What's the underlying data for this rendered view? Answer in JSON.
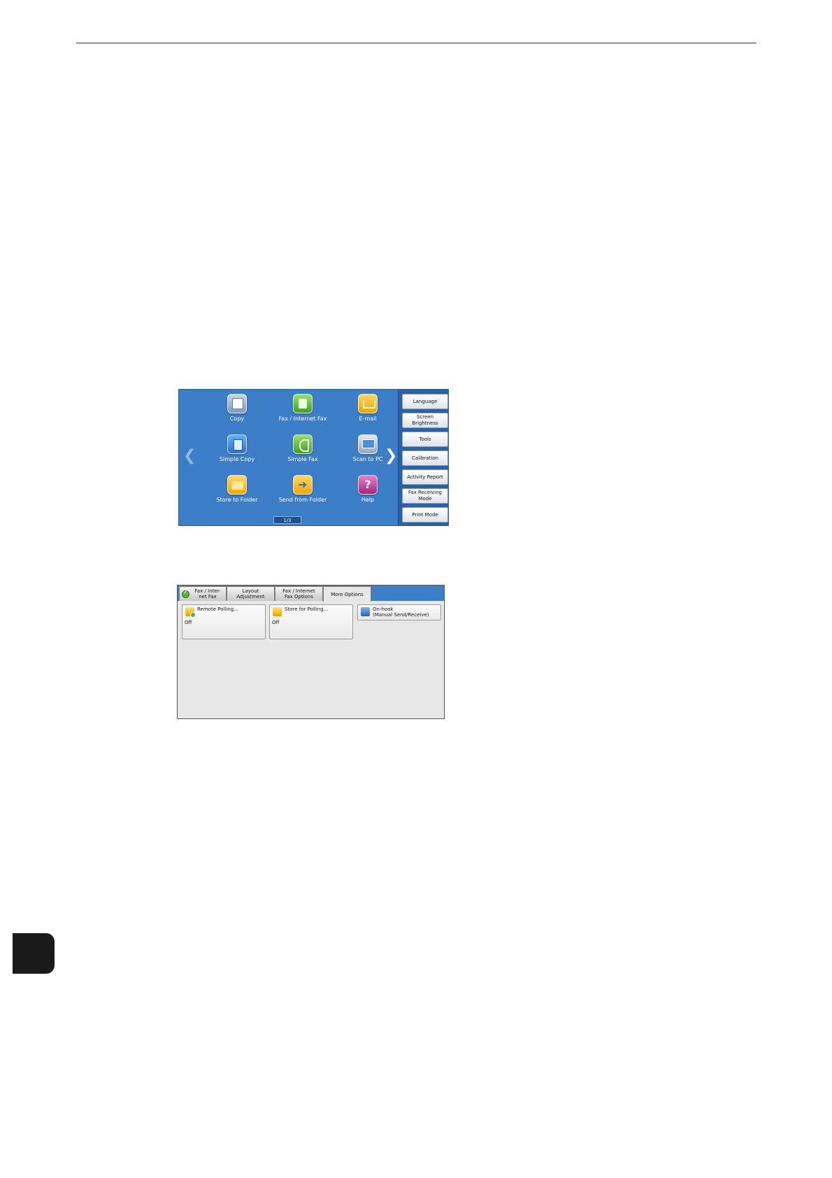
{
  "home": {
    "apps": [
      {
        "label": "Copy",
        "icon": "copy-icon"
      },
      {
        "label": "Fax / Internet Fax",
        "icon": "fax-icon"
      },
      {
        "label": "E-mail",
        "icon": "email-icon"
      },
      {
        "label": "Simple Copy",
        "icon": "simple-copy-icon"
      },
      {
        "label": "Simple Fax",
        "icon": "simple-fax-icon"
      },
      {
        "label": "Scan to PC",
        "icon": "scan-to-pc-icon"
      },
      {
        "label": "Store to Folder",
        "icon": "folder-icon"
      },
      {
        "label": "Send from Folder",
        "icon": "send-from-folder-icon"
      },
      {
        "label": "Help",
        "icon": "help-icon"
      }
    ],
    "page_indicator": "1/3",
    "side_buttons": [
      {
        "label": "Language"
      },
      {
        "label": "Screen Brightness"
      },
      {
        "label": "Tools"
      },
      {
        "label": "Calibration"
      },
      {
        "label": "Activity Report"
      },
      {
        "label": "Fax Receiving Mode"
      },
      {
        "label": "Print Mode"
      }
    ]
  },
  "fax_screen": {
    "tabs": [
      {
        "label": "Fax / Inter-\nnet Fax",
        "active": false
      },
      {
        "label": "Layout\nAdjustment",
        "active": false
      },
      {
        "label": "Fax / Internet\nFax Options",
        "active": false
      },
      {
        "label": "More Options",
        "active": true
      }
    ],
    "options": [
      {
        "label": "Remote Polling...",
        "value": "Off",
        "icon": "remote-polling-icon"
      },
      {
        "label": "Store for Polling...",
        "value": "Off",
        "icon": "store-for-polling-icon"
      },
      {
        "label": "On-hook\n(Manual Send/Receive)",
        "icon": "telephone-icon"
      }
    ]
  },
  "colors": {
    "home_background": "#3d7ec9",
    "side_panel": "#2b62a6",
    "fax_panel": "#e7e7e7"
  }
}
